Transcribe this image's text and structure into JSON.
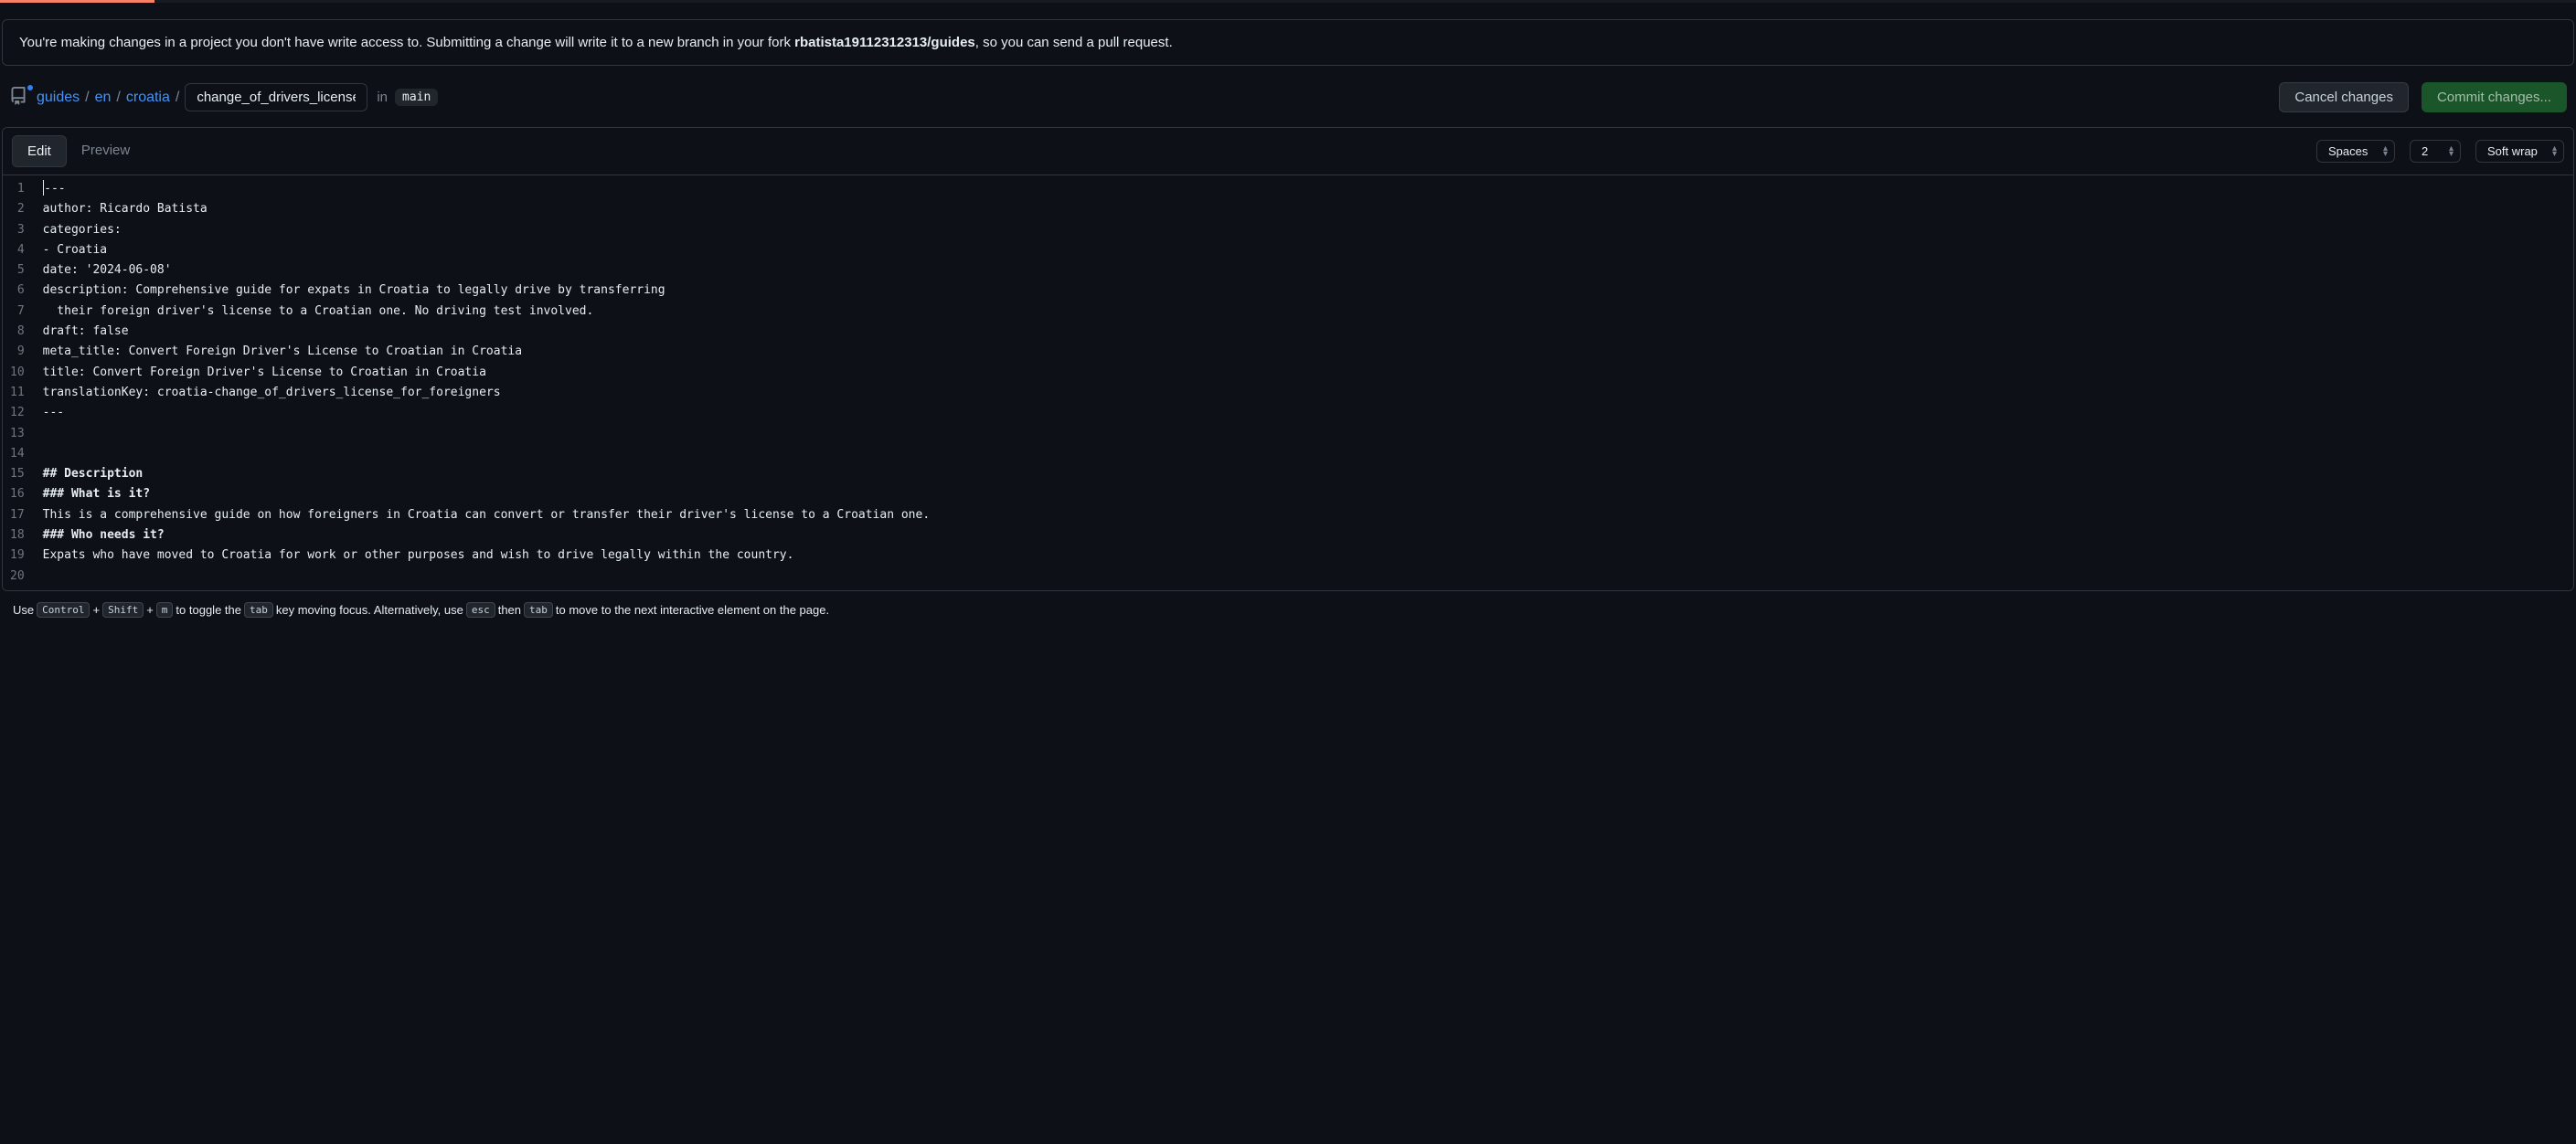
{
  "progress_percent": 6,
  "banner": {
    "prefix": "You're making changes in a project you don't have write access to. Submitting a change will write it to a new branch in your fork ",
    "fork": "rbatista19112312313/guides",
    "suffix": ", so you can send a pull request."
  },
  "breadcrumb": {
    "repo": "guides",
    "parts": [
      "en",
      "croatia"
    ],
    "filename_value": "change_of_drivers_license_for_foreigners.md",
    "in_label": "in",
    "branch": "main"
  },
  "actions": {
    "cancel": "Cancel changes",
    "commit": "Commit changes..."
  },
  "tabs": {
    "edit": "Edit",
    "preview": "Preview"
  },
  "toolbar": {
    "indent_mode": "Spaces",
    "indent_size": "2",
    "wrap_mode": "Soft wrap"
  },
  "code": {
    "lines": [
      {
        "n": 1,
        "text": "---",
        "cursor_before": true
      },
      {
        "n": 2,
        "text": "author: Ricardo Batista"
      },
      {
        "n": 3,
        "text": "categories:"
      },
      {
        "n": 4,
        "text": "- Croatia"
      },
      {
        "n": 5,
        "text": "date: '2024-06-08'"
      },
      {
        "n": 6,
        "text": "description: Comprehensive guide for expats in Croatia to legally drive by transferring"
      },
      {
        "n": 7,
        "text": "  their foreign driver's license to a Croatian one. No driving test involved."
      },
      {
        "n": 8,
        "text": "draft: false"
      },
      {
        "n": 9,
        "text": "meta_title: Convert Foreign Driver's License to Croatian in Croatia"
      },
      {
        "n": 10,
        "text": "title: Convert Foreign Driver's License to Croatian in Croatia"
      },
      {
        "n": 11,
        "text": "translationKey: croatia-change_of_drivers_license_for_foreigners"
      },
      {
        "n": 12,
        "text": "---"
      },
      {
        "n": 13,
        "text": ""
      },
      {
        "n": 14,
        "text": ""
      },
      {
        "n": 15,
        "text": "## Description",
        "bold": true
      },
      {
        "n": 16,
        "text": "### What is it?",
        "bold": true
      },
      {
        "n": 17,
        "text": "This is a comprehensive guide on how foreigners in Croatia can convert or transfer their driver's license to a Croatian one."
      },
      {
        "n": 18,
        "text": "### Who needs it?",
        "bold": true
      },
      {
        "n": 19,
        "text": "Expats who have moved to Croatia for work or other purposes and wish to drive legally within the country."
      },
      {
        "n": 20,
        "text": ""
      }
    ]
  },
  "footer": {
    "use": "Use",
    "k1": "Control",
    "plus": "+",
    "k2": "Shift",
    "k3": "m",
    "to_toggle": "to toggle the",
    "k4": "tab",
    "moving": "key moving focus. Alternatively, use",
    "k5": "esc",
    "then": "then",
    "k6": "tab",
    "tomove": "to move to the next interactive element on the page."
  }
}
